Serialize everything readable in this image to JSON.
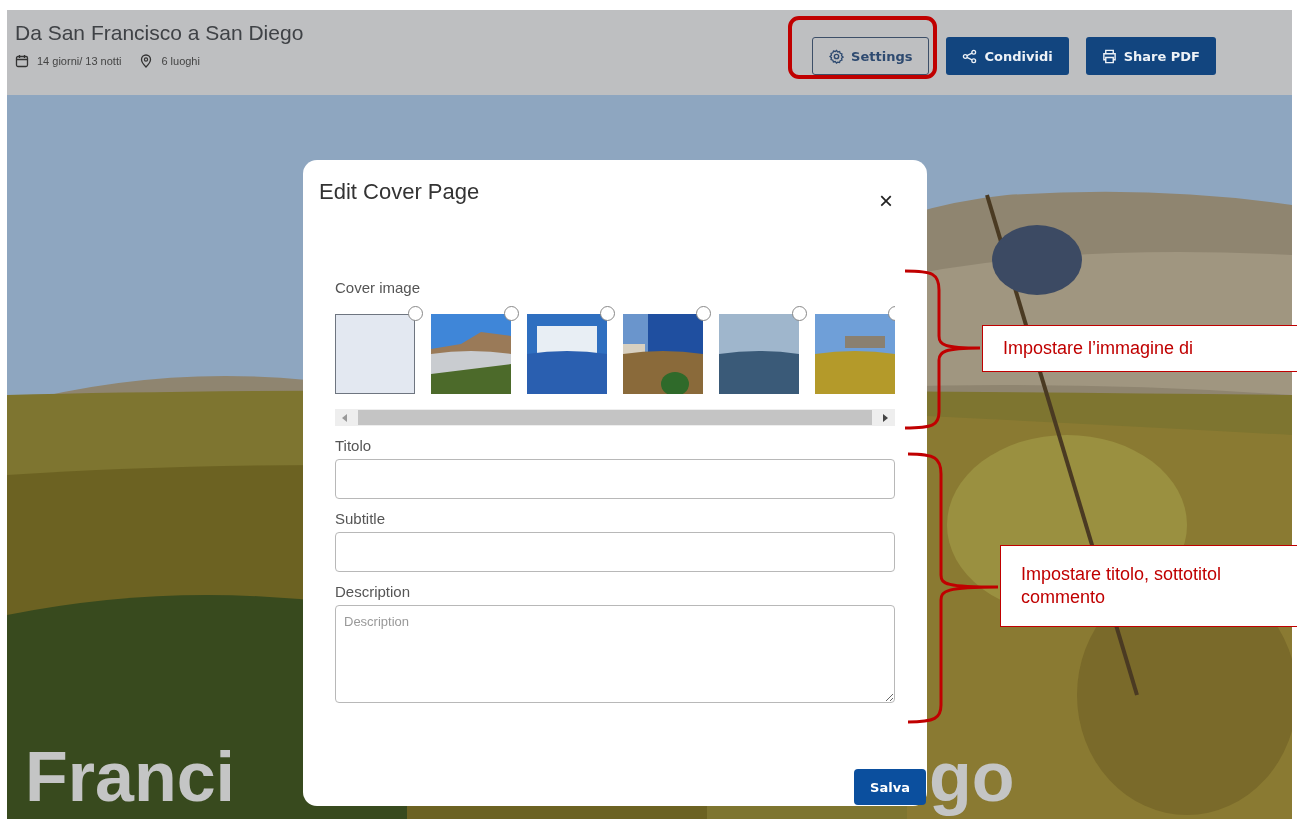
{
  "header": {
    "title": "Da San Francisco a San Diego",
    "duration": "14 giorni/ 13 notti",
    "places": "6 luoghi",
    "buttons": [
      {
        "label": "Settings",
        "kind": "settings"
      },
      {
        "label": "Condividi",
        "kind": "share"
      },
      {
        "label": "Share PDF",
        "kind": "print"
      }
    ]
  },
  "hero": {
    "visible_parts": [
      "Franci",
      "go"
    ]
  },
  "modal": {
    "title": "Edit Cover Page",
    "close": "×",
    "cover_label": "Cover image",
    "thumbnails": [
      {
        "kind": "empty",
        "selected": false
      },
      {
        "kind": "picture",
        "selected": false
      },
      {
        "kind": "picture",
        "selected": false
      },
      {
        "kind": "picture",
        "selected": false
      },
      {
        "kind": "picture",
        "selected": false
      },
      {
        "kind": "picture",
        "selected": false
      }
    ],
    "fields": [
      {
        "label": "Titolo",
        "kind": "input"
      },
      {
        "label": "Subtitle",
        "kind": "input"
      },
      {
        "label": "Description",
        "kind": "textarea",
        "placeholder": "Description"
      }
    ],
    "save": "Salva"
  },
  "annotations": [
    {
      "lines": [
        "Impostare l’immagine di"
      ]
    },
    {
      "lines": [
        "Impostare titolo, sottotitol",
        "commento"
      ]
    }
  ]
}
